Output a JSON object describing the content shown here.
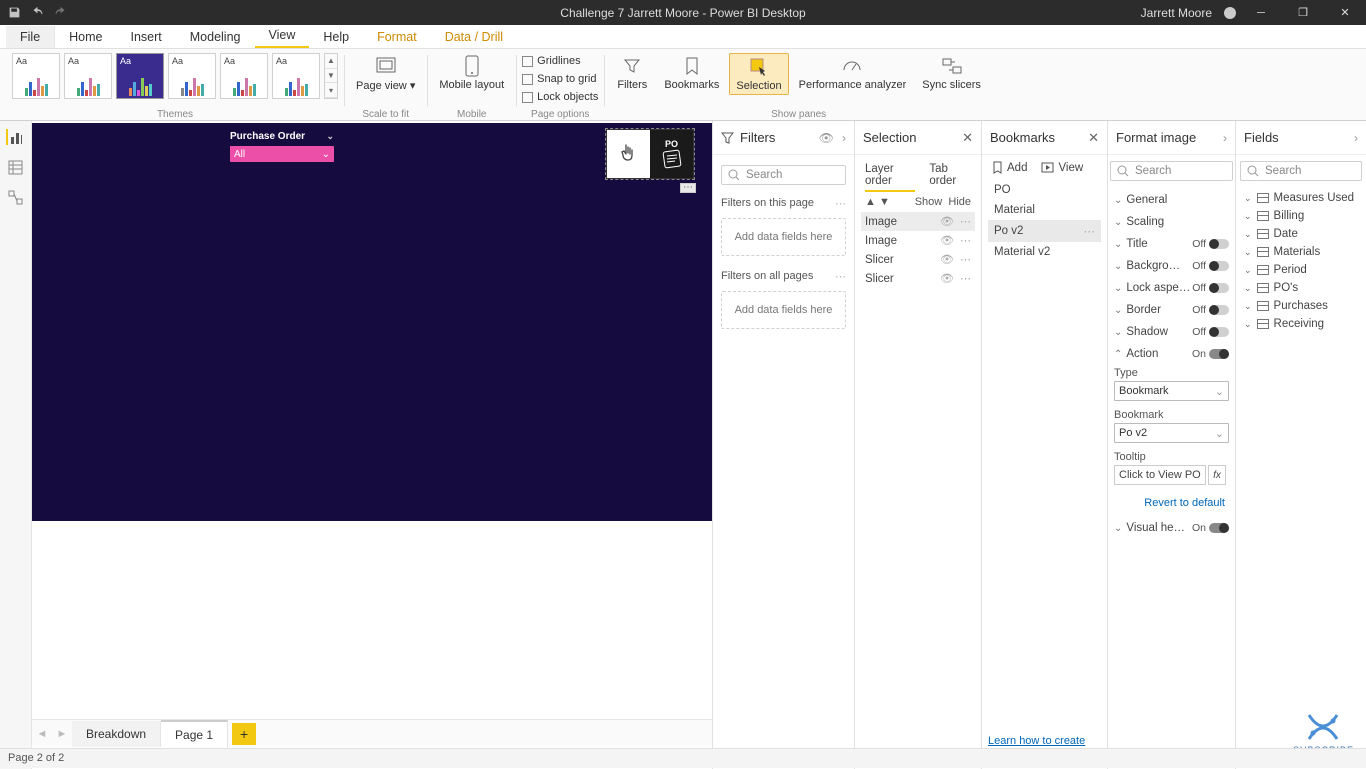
{
  "titlebar": {
    "title": "Challenge 7 Jarrett Moore - Power BI Desktop",
    "user": "Jarrett Moore"
  },
  "tabs": {
    "file": "File",
    "items": [
      "Home",
      "Insert",
      "Modeling",
      "View",
      "Help",
      "Format",
      "Data / Drill"
    ],
    "activeIndex": 3,
    "yellowIndexes": [
      5,
      6
    ]
  },
  "ribbon": {
    "themes_label": "Themes",
    "scale_label": "Scale to fit",
    "mobile_label": "Mobile",
    "page_options_label": "Page options",
    "show_panes_label": "Show panes",
    "page_view": "Page view",
    "page_view_suffix": " ▾",
    "mobile_layout": "Mobile layout",
    "gridlines": "Gridlines",
    "snap": "Snap to grid",
    "lock": "Lock objects",
    "filters": "Filters",
    "bookmarks": "Bookmarks",
    "selection": "Selection",
    "perf": "Performance analyzer",
    "sync": "Sync slicers"
  },
  "canvas": {
    "slicer_title": "Purchase Order",
    "slicer_value": "All",
    "card_label": "PO"
  },
  "filters_pane": {
    "title": "Filters",
    "search": "Search",
    "on_page": "Filters on this page",
    "on_all": "Filters on all pages",
    "add": "Add data fields here"
  },
  "selection_pane": {
    "title": "Selection",
    "layer": "Layer order",
    "tab": "Tab order",
    "show": "Show",
    "hide": "Hide",
    "items": [
      "Image",
      "Image",
      "Slicer",
      "Slicer"
    ]
  },
  "bookmarks_pane": {
    "title": "Bookmarks",
    "add": "Add",
    "view": "View",
    "items": [
      "PO",
      "Material",
      "Po v2",
      "Material v2"
    ],
    "learn": "Learn how to create and edit bookmarks"
  },
  "format_pane": {
    "title": "Format image",
    "search": "Search",
    "sections": {
      "general": "General",
      "scaling": "Scaling",
      "title": "Title",
      "background": "Backgro…",
      "lock": "Lock aspe…",
      "border": "Border",
      "shadow": "Shadow",
      "action": "Action",
      "visual_header": "Visual he…"
    },
    "off": "Off",
    "on": "On",
    "type_label": "Type",
    "type_value": "Bookmark",
    "bookmark_label": "Bookmark",
    "bookmark_value": "Po v2",
    "tooltip_label": "Tooltip",
    "tooltip_value": "Click to View PO",
    "revert": "Revert to default"
  },
  "fields_pane": {
    "title": "Fields",
    "search": "Search",
    "tables": [
      "Measures Used",
      "Billing",
      "Date",
      "Materials",
      "Period",
      "PO's",
      "Purchases",
      "Receiving"
    ]
  },
  "pagetabs": {
    "tabs": [
      "Breakdown",
      "Page 1"
    ],
    "activeIndex": 1
  },
  "status": "Page 2 of 2",
  "subscribe": "SUBSCRIBE"
}
